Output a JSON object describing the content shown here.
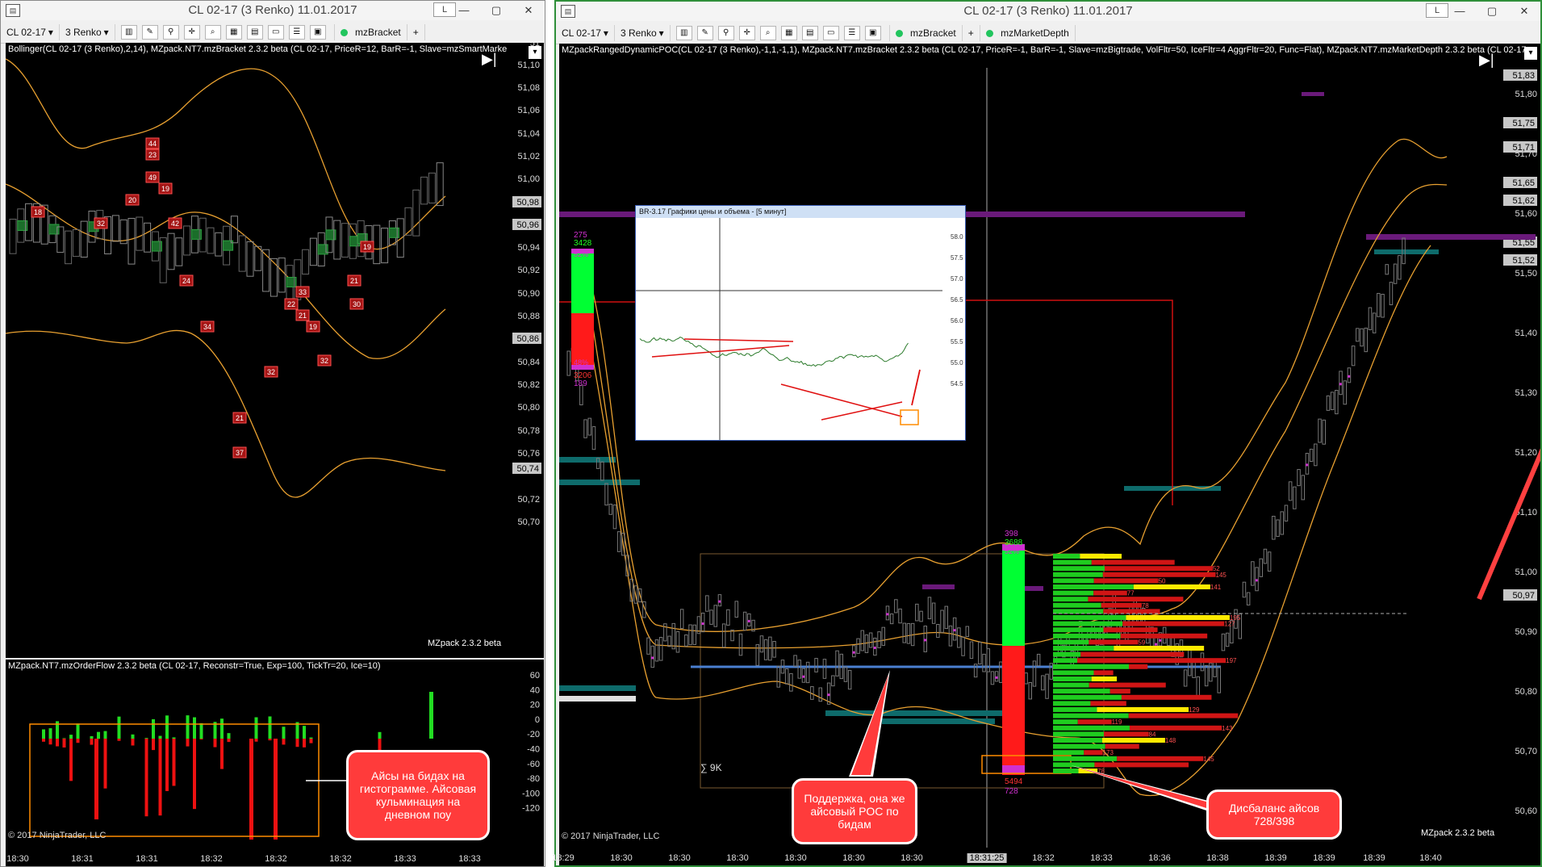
{
  "left_window": {
    "title": "CL 02-17 (3 Renko)  11.01.2017",
    "title_button": "L",
    "controls": [
      "—",
      "▢",
      "✕"
    ],
    "toolbar": {
      "instrument": "CL 02-17",
      "period": "3 Renko",
      "strategy": "mzBracket",
      "add": "+"
    },
    "price_panel": {
      "indicator_title": "Bollinger(CL 02-17 (3 Renko),2,14), MZpack.NT7.mzBracket 2.3.2 beta (CL 02-17, PriceR=12, BarR=-1, Slave=mzSmartMarke",
      "y_labels": [
        "51,10",
        "51,08",
        "51,06",
        "51,04",
        "51,02",
        "51,00",
        "50,94",
        "50,92",
        "50,90",
        "50,88",
        "50,84",
        "50,82",
        "50,80",
        "50,78",
        "50,76",
        "50,72",
        "50,70"
      ],
      "y_tags": [
        "50,98",
        "50,96",
        "50,86",
        "50,74"
      ],
      "top_label": "51",
      "badges": [
        "44",
        "23",
        "49",
        "19",
        "20",
        "18",
        "32",
        "42",
        "24",
        "33",
        "22",
        "21",
        "34",
        "19",
        "30",
        "21",
        "19",
        "32",
        "32",
        "21",
        "37"
      ],
      "brand": "MZpack 2.3.2 beta"
    },
    "orderflow_panel": {
      "indicator_title": "MZpack.NT7.mzOrderFlow 2.3.2 beta (CL 02-17, Reconstr=True, Exp=100, TickTr=20, Ice=10)",
      "y_labels": [
        "60",
        "40",
        "20",
        "0",
        "-20",
        "-40",
        "-60",
        "-80",
        "-100",
        "-120"
      ],
      "copyright": "© 2017 NinjaTrader, LLC"
    },
    "x_labels": [
      "18:30",
      "18:31",
      "18:31",
      "18:32",
      "18:32",
      "18:32",
      "18:33",
      "18:33"
    ],
    "callout": "Айсы на бидах на гистограмме. Айсовая кульминация на дневном поу"
  },
  "right_window": {
    "title": "CL 02-17 (3 Renko)  11.01.2017",
    "title_button": "L",
    "controls": [
      "—",
      "▢",
      "✕"
    ],
    "toolbar": {
      "instrument": "CL 02-17",
      "period": "3 Renko",
      "strategy": "mzBracket",
      "add": "+",
      "strategy2": "mzMarketDepth"
    },
    "indicator_title": "MZpackRangedDynamicPOC(CL 02-17 (3 Renko),-1,1,-1,1), MZpack.NT7.mzBracket 2.3.2 beta (CL 02-17, PriceR=-1, BarR=-1, Slave=mzBigtrade, VolFltr=50, IceFltr=4 AggrFltr=20, Func=Flat), MZpack.NT7.mzMarketDepth 2.3.2 beta (CL 02-17,",
    "y_labels": [
      "51,80",
      "51,70",
      "51,60",
      "51,50",
      "51,40",
      "51,30",
      "51,20",
      "51,10",
      "51,00",
      "50,90",
      "50,80",
      "50,70",
      "50,60"
    ],
    "y_tags": [
      "51,83",
      "51,75",
      "51,71",
      "51,65",
      "51,62",
      "51,55",
      "51,52",
      "50,97"
    ],
    "x_labels": [
      "18:29",
      "18:30",
      "18:30",
      "18:30",
      "18:30",
      "18:30",
      "18:30",
      "18:31",
      "18:32",
      "18:33",
      "18:36",
      "18:38",
      "18:39",
      "18:39",
      "18:39",
      "18:40"
    ],
    "crosshair_time": "18:31:25",
    "sigma_label": "∑ 9K",
    "volume_bar_left": {
      "top1": "275",
      "top2": "3428",
      "top_pct": "52%",
      "bot_pct": "48%",
      "bot1": "3206",
      "bot2": "189"
    },
    "volume_bar_right": {
      "top1": "398",
      "top2": "3688",
      "top_pct": "52%",
      "bot_pct": "58%",
      "bot1": "5494",
      "bot2": "728"
    },
    "inset": {
      "title": "BR-3.17 Графики цены и объема - [5 минут]",
      "y_labels": [
        "58.0",
        "57.5",
        "57.0",
        "56.5",
        "56.0",
        "55.5",
        "55.0",
        "54.5"
      ]
    },
    "brand": "MZpack 2.3.2 beta",
    "copyright": "© 2017 NinjaTrader, LLC",
    "callouts": {
      "support": "Поддержка, она же айсовый POC по бидам",
      "imbalance": "Дисбаланс айсов 728/398"
    },
    "colors": {
      "background": "#000000",
      "bull_green": "#00ff33",
      "bear_red": "#ff1a1a",
      "bands": "#e8a030",
      "poc_blue": "#4a7fd0",
      "ice_cyan": "#0e6b6b",
      "ice_purple": "#6a1a7a",
      "annotation": "#ff4040"
    }
  }
}
